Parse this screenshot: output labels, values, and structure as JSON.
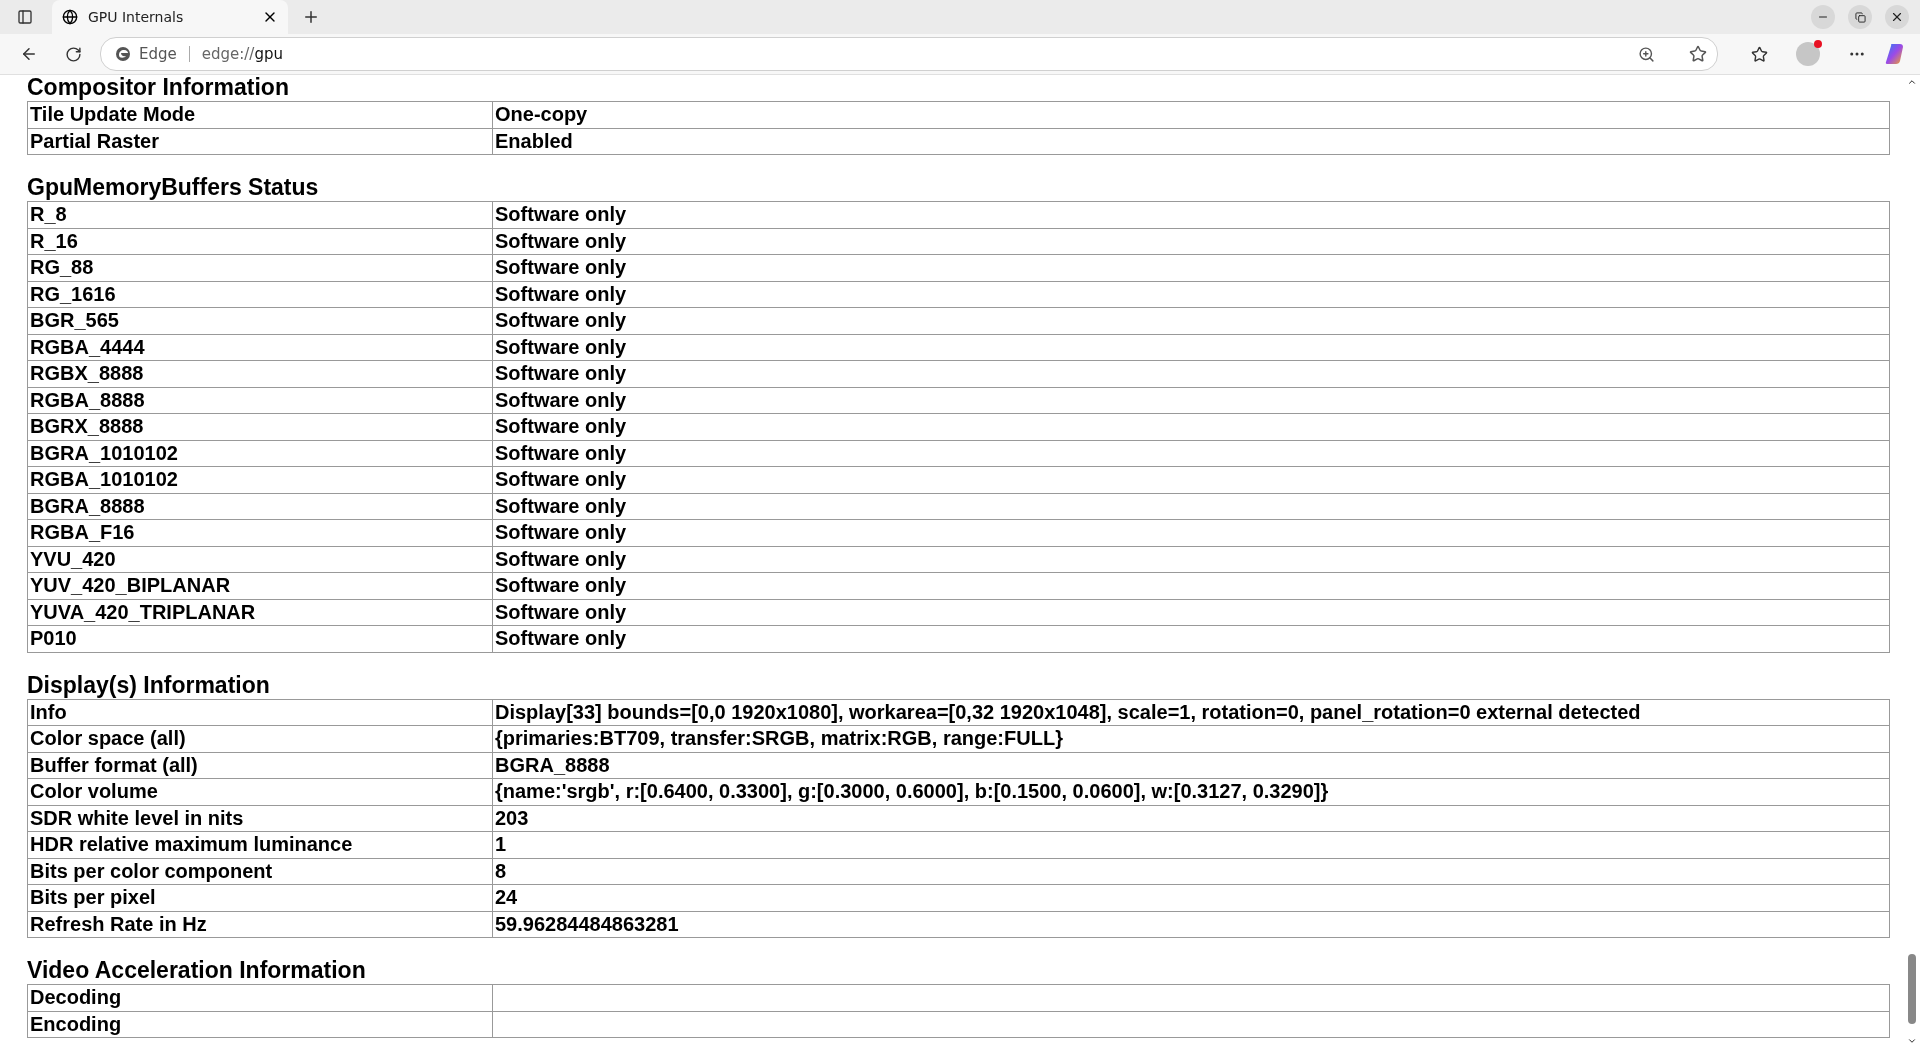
{
  "browser": {
    "tab_title": "GPU Internals",
    "site_label": "Edge",
    "url_scheme": "edge://",
    "url_path": "gpu"
  },
  "sections": [
    {
      "title": "Compositor Information",
      "rows": [
        {
          "label": "Tile Update Mode",
          "value": "One-copy"
        },
        {
          "label": "Partial Raster",
          "value": "Enabled"
        }
      ]
    },
    {
      "title": "GpuMemoryBuffers Status",
      "rows": [
        {
          "label": "R_8",
          "value": "Software only"
        },
        {
          "label": "R_16",
          "value": "Software only"
        },
        {
          "label": "RG_88",
          "value": "Software only"
        },
        {
          "label": "RG_1616",
          "value": "Software only"
        },
        {
          "label": "BGR_565",
          "value": "Software only"
        },
        {
          "label": "RGBA_4444",
          "value": "Software only"
        },
        {
          "label": "RGBX_8888",
          "value": "Software only"
        },
        {
          "label": "RGBA_8888",
          "value": "Software only"
        },
        {
          "label": "BGRX_8888",
          "value": "Software only"
        },
        {
          "label": "BGRA_1010102",
          "value": "Software only"
        },
        {
          "label": "RGBA_1010102",
          "value": "Software only"
        },
        {
          "label": "BGRA_8888",
          "value": "Software only"
        },
        {
          "label": "RGBA_F16",
          "value": "Software only"
        },
        {
          "label": "YVU_420",
          "value": "Software only"
        },
        {
          "label": "YUV_420_BIPLANAR",
          "value": "Software only"
        },
        {
          "label": "YUVA_420_TRIPLANAR",
          "value": "Software only"
        },
        {
          "label": "P010",
          "value": "Software only"
        }
      ]
    },
    {
      "title": "Display(s) Information",
      "rows": [
        {
          "label": "Info",
          "value": "Display[33] bounds=[0,0 1920x1080], workarea=[0,32 1920x1048], scale=1, rotation=0, panel_rotation=0 external detected"
        },
        {
          "label": "Color space (all)",
          "value": "{primaries:BT709, transfer:SRGB, matrix:RGB, range:FULL}"
        },
        {
          "label": "Buffer format (all)",
          "value": "BGRA_8888"
        },
        {
          "label": "Color volume",
          "value": "{name:'srgb', r:[0.6400, 0.3300], g:[0.3000, 0.6000], b:[0.1500, 0.0600], w:[0.3127, 0.3290]}"
        },
        {
          "label": "SDR white level in nits",
          "value": "203"
        },
        {
          "label": "HDR relative maximum luminance",
          "value": "1"
        },
        {
          "label": "Bits per color component",
          "value": "8"
        },
        {
          "label": "Bits per pixel",
          "value": "24"
        },
        {
          "label": "Refresh Rate in Hz",
          "value": "59.96284484863281"
        }
      ]
    },
    {
      "title": "Video Acceleration Information",
      "rows": [
        {
          "label": "Decoding"
        },
        {
          "label": "Encoding"
        }
      ]
    }
  ]
}
